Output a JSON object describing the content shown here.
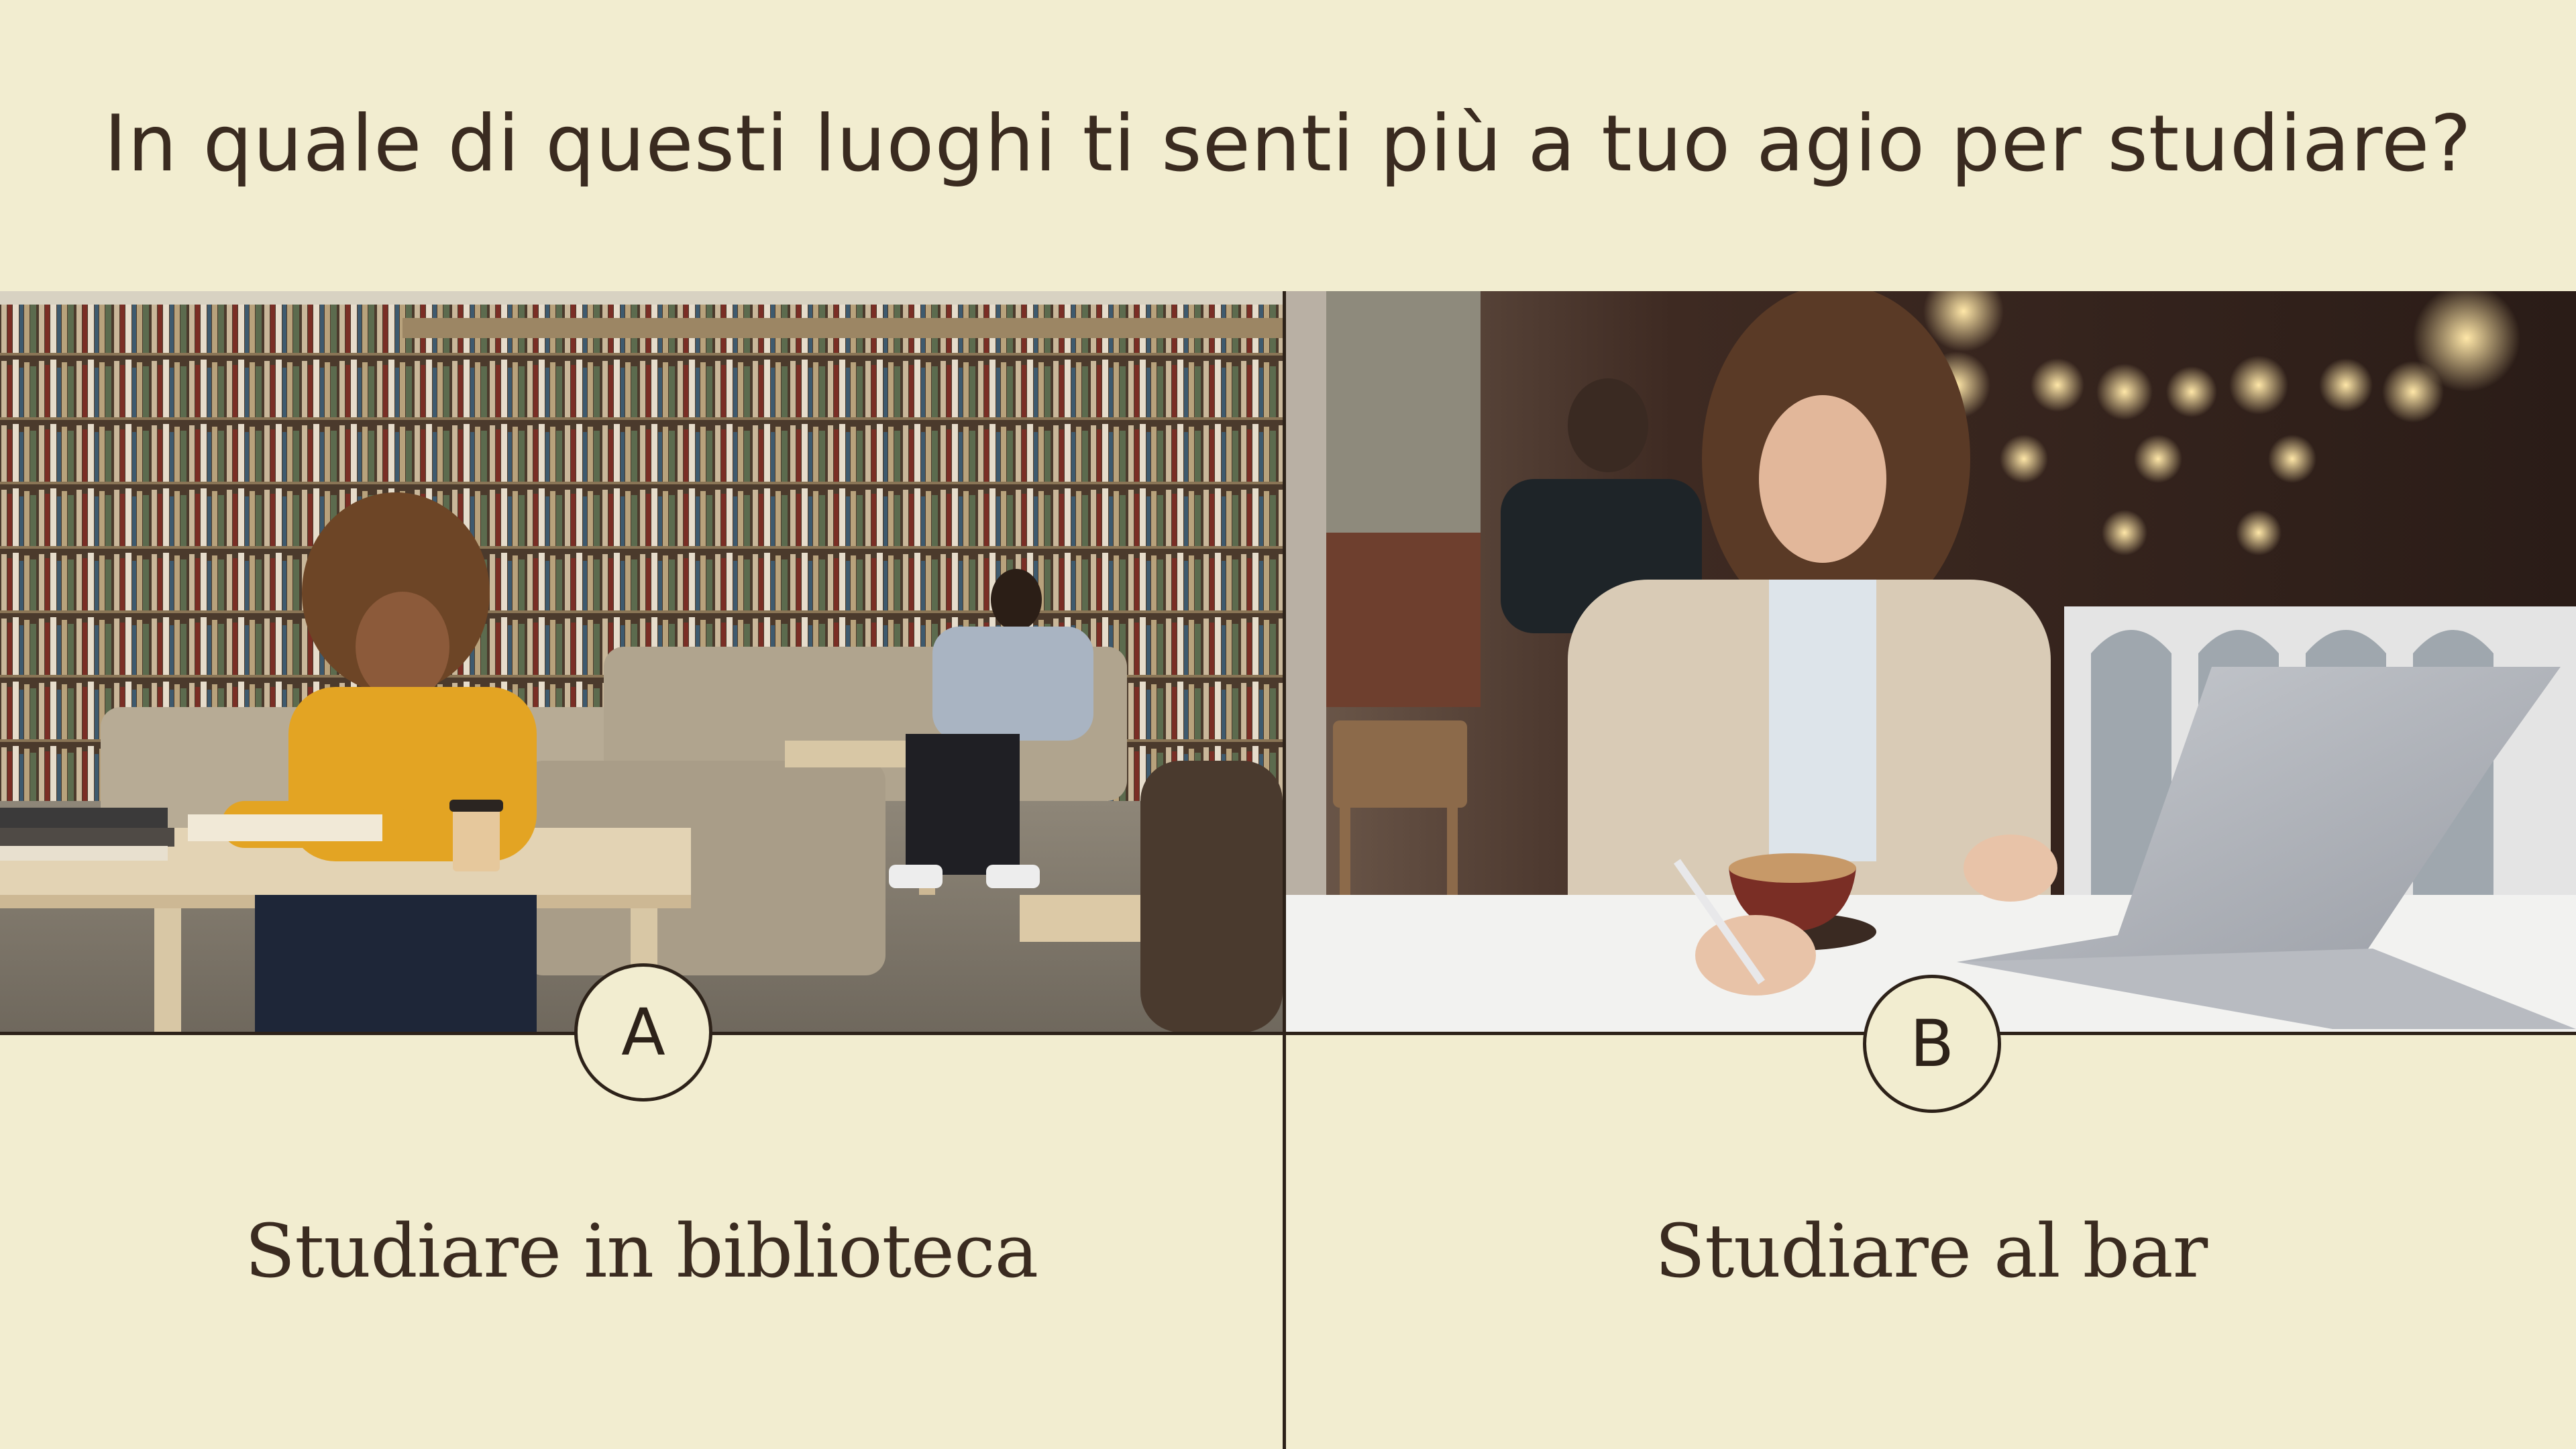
{
  "question": "In quale di questi luoghi ti senti più a tuo agio per studiare?",
  "options": [
    {
      "badge": "A",
      "label": "Studiare in biblioteca",
      "photo_subject": "library-photo"
    },
    {
      "badge": "B",
      "label": "Studiare al bar",
      "photo_subject": "cafe-photo"
    }
  ],
  "colors": {
    "background": "#F2EDD0",
    "text": "#3A2B20",
    "lines": "#2D2219"
  }
}
